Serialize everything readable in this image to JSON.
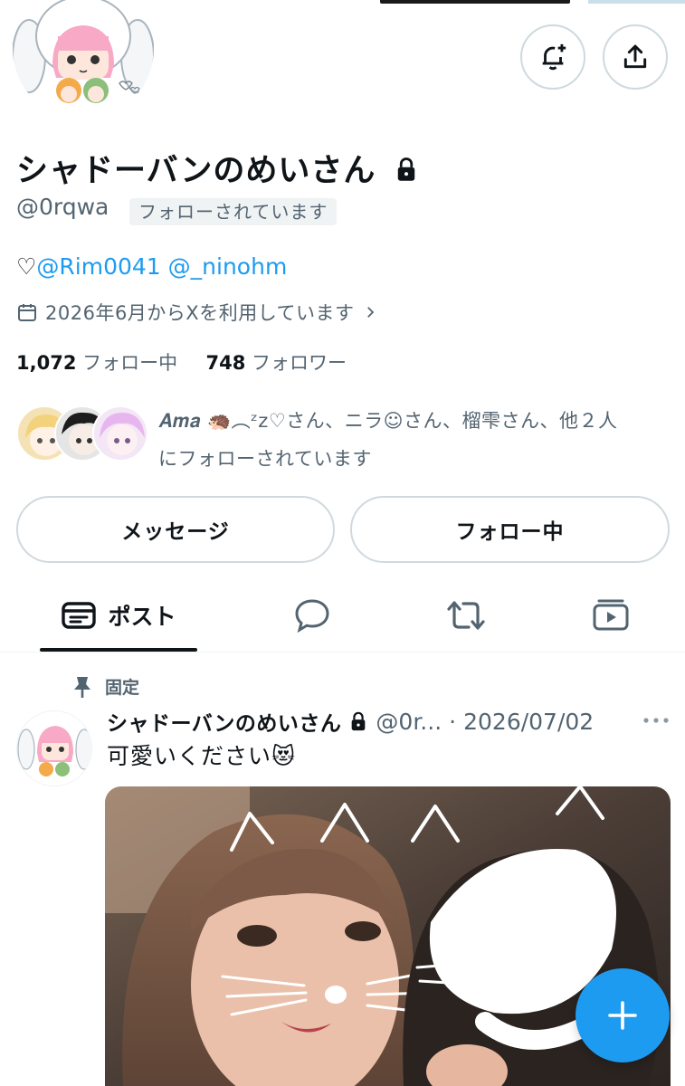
{
  "profile": {
    "display_name": "シャドーバンのめいさん",
    "handle": "@0rqwa",
    "followed_badge": "フォローされています",
    "bio_prefix": "♡",
    "bio_link1": "@Rim0041",
    "bio_link2": "@_ninohm",
    "joined": "2026年6月からXを利用しています",
    "following_count": "1,072",
    "following_label": "フォロー中",
    "followers_count": "748",
    "followers_label": "フォロワー",
    "mutual_line1": "𝑨𝒎𝒂 🦔︵ᶻz♡さん、ニラ☺さん、榴雫さん、他２人",
    "mutual_line2": "にフォローされています"
  },
  "actions": {
    "message_label": "メッセージ",
    "following_label": "フォロー中"
  },
  "tabs": [
    {
      "label": "ポスト",
      "icon": "posts-icon",
      "active": true
    },
    {
      "label": "",
      "icon": "reply-icon"
    },
    {
      "label": "",
      "icon": "repost-icon"
    },
    {
      "label": "",
      "icon": "media-icon"
    }
  ],
  "pinned_post": {
    "pinned_label": "固定",
    "author": "シャドーバンのめいさん",
    "handle_trunc": "@0r...",
    "date": "2026/07/02",
    "text": "可愛いください😻"
  },
  "colors": {
    "accent": "#1d9bf0",
    "text": "#0f1419",
    "secondary": "#536471",
    "border": "#cfd9de"
  }
}
